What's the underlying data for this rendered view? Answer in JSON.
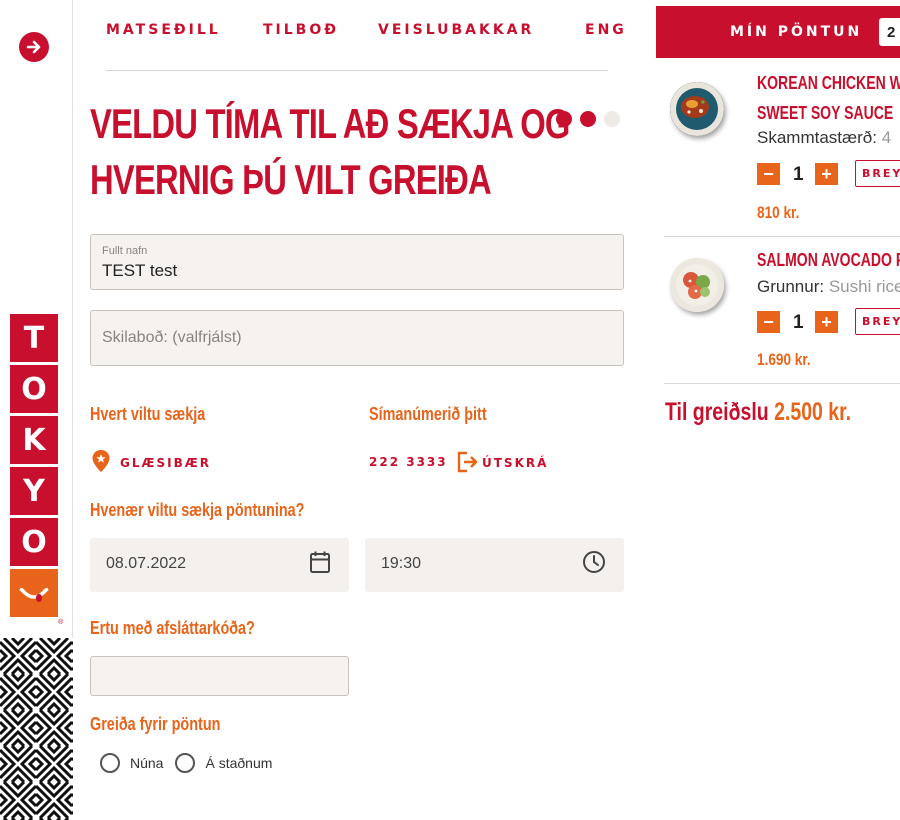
{
  "nav": {
    "items": [
      "MATSEÐILL",
      "TILBOÐ",
      "VEISLUBAKKAR",
      "ENG"
    ],
    "cart_label": "MÍN PÖNTUN",
    "cart_count": "2"
  },
  "logo_letters": [
    "T",
    "O",
    "K",
    "Y",
    "O"
  ],
  "logo_reg": "®",
  "page": {
    "title_line1": "VELDU TÍMA TIL AÐ SÆKJA OG",
    "title_line2": "HVERNIG ÞÚ VILT GREIÐA",
    "step_total": 3,
    "step_current": 2
  },
  "form": {
    "name_label": "Fullt nafn",
    "name_value": "TEST test",
    "message_placeholder": "Skilaboð: (valfrjálst)",
    "location_label": "Hvert viltu sækja",
    "location_value": "GLÆSIBÆR",
    "phone_label": "Símanúmerið þitt",
    "phone_value": "222 3333",
    "logout_label": "ÚTSKRÁ",
    "when_label": "Hvenær viltu sækja pöntunina?",
    "date_value": "08.07.2022",
    "time_value": "19:30",
    "discount_label": "Ertu með afsláttarkóða?",
    "pay_label": "Greiða fyrir pöntun",
    "pay_options": [
      "Núna",
      "Á staðnum"
    ]
  },
  "cart": {
    "items": [
      {
        "name_line1": "KOREAN CHICKEN WI",
        "name_line2": "SWEET SOY SAUCE",
        "meta_key": "Skammtastærð:",
        "meta_value": "4",
        "qty": "1",
        "edit_label": "BREYTA",
        "price": "810 kr."
      },
      {
        "name_line1": "SALMON AVOCADO PO",
        "meta_key": "Grunnur:",
        "meta_value": "Sushi rice",
        "qty": "1",
        "edit_label": "BREYTA",
        "price": "1.690 kr."
      }
    ],
    "total_label": "Til greiðslu",
    "total_value": "2.500 kr."
  },
  "colors": {
    "brand_red": "#c8102e",
    "accent_orange": "#e8641b",
    "field_bg": "#f5f2ef"
  }
}
